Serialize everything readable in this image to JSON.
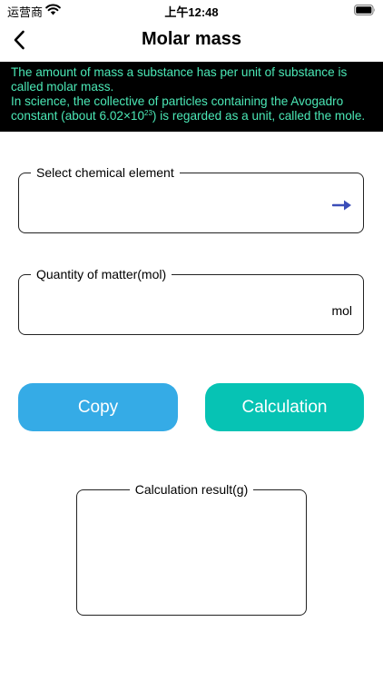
{
  "status_bar": {
    "carrier": "运营商",
    "time": "上午12:48"
  },
  "nav": {
    "title": "Molar mass",
    "back_icon": "chevron-left-icon"
  },
  "info": {
    "line1": "The amount of mass a substance has per unit of substance is called molar mass.",
    "line2": "In science, the collective of particles containing the Avogadro constant (about 6.02×10",
    "line2_sup": "23",
    "line2_end": ") is regarded as a unit, called the mole.",
    "text_color": "#4be8b6",
    "bg_color": "#000000"
  },
  "element_field": {
    "label": "Select chemical element",
    "value": "",
    "arrow_icon": "arrow-right-icon",
    "arrow_color": "#3b4db8"
  },
  "quantity_field": {
    "label": "Quantity of matter(mol)",
    "value": "",
    "unit": "mol"
  },
  "buttons": {
    "copy_label": "Copy",
    "copy_color": "#35abe6",
    "calculation_label": "Calculation",
    "calculation_color": "#06c3b4"
  },
  "result": {
    "label": "Calculation result(g)",
    "value": ""
  }
}
